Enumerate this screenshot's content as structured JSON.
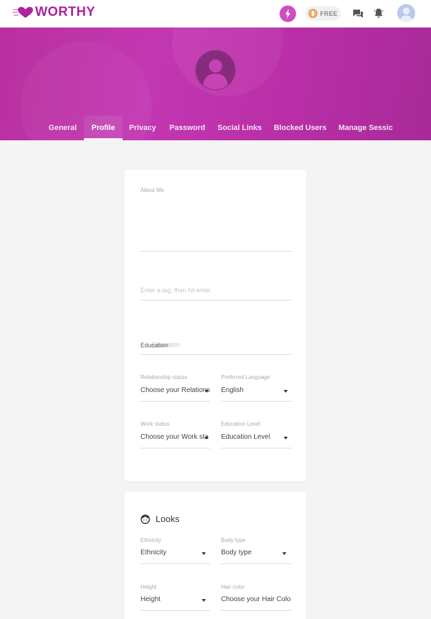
{
  "app": {
    "brand": "WORTHY",
    "free_label": "FREE",
    "colors": {
      "brand": "#a8249a",
      "header": "#c338b2",
      "bolt": "#cc4fc2"
    }
  },
  "icons": {
    "logo": "heart-icon",
    "boost": "bolt-icon",
    "coin": "coin-icon",
    "messages": "chat-icon",
    "notifications": "bell-icon",
    "account": "user-avatar",
    "looks": "face-icon"
  },
  "tabs": [
    {
      "label": "General"
    },
    {
      "label": "Profile",
      "active": true
    },
    {
      "label": "Privacy"
    },
    {
      "label": "Password"
    },
    {
      "label": "Social Links"
    },
    {
      "label": "Blocked Users"
    },
    {
      "label": "Manage Sessic"
    }
  ],
  "profile": {
    "about_label": "About Me",
    "tags_placeholder": "Enter a tag, then hit enter",
    "education_label": "Education",
    "education_placeholder": "Education",
    "relationship_label": "Relationship status",
    "relationship_value": "Choose your Relations",
    "language_label": "Preferred Language",
    "language_value": "English",
    "work_label": "Work status",
    "work_value": "Choose your Work sta",
    "education_level_label": "Education Level",
    "education_level_value": "Education Level"
  },
  "looks": {
    "title": "Looks",
    "ethnicity_label": "Ethnicity",
    "ethnicity_value": "Ethnicity",
    "body_label": "Body type",
    "body_value": "Body type",
    "height_label": "Height",
    "height_value": "Height",
    "hair_label": "Hair color",
    "hair_value": "Choose your Hair Colo"
  }
}
